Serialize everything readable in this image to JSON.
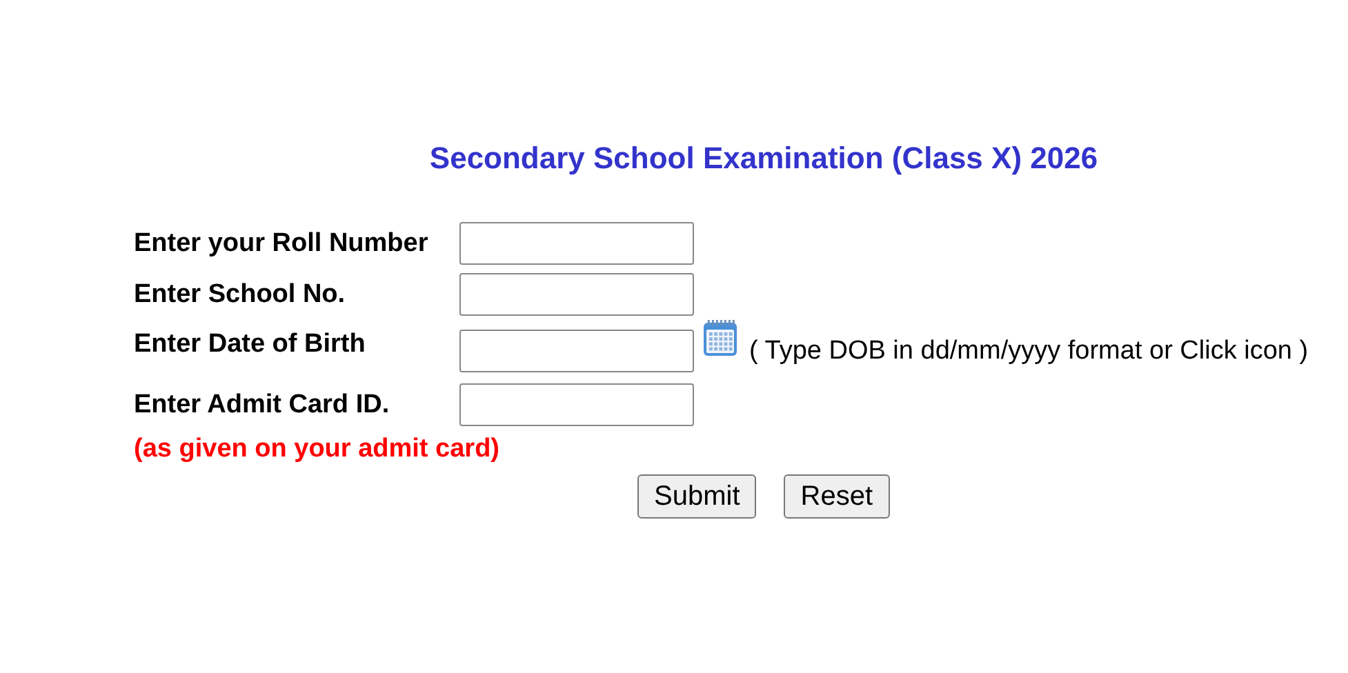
{
  "title": "Secondary School Examination (Class X) 2026",
  "fields": [
    {
      "kind": "text",
      "label": "Enter your Roll Number"
    },
    {
      "kind": "text",
      "label": "Enter School No."
    },
    {
      "kind": "date",
      "label": "Enter Date of Birth",
      "hint": "( Type DOB in dd/mm/yyyy format or Click icon )"
    },
    {
      "kind": "text",
      "label": "Enter Admit Card ID."
    }
  ],
  "note": "(as given on your admit card)",
  "buttons": [
    "Submit",
    "Reset"
  ]
}
